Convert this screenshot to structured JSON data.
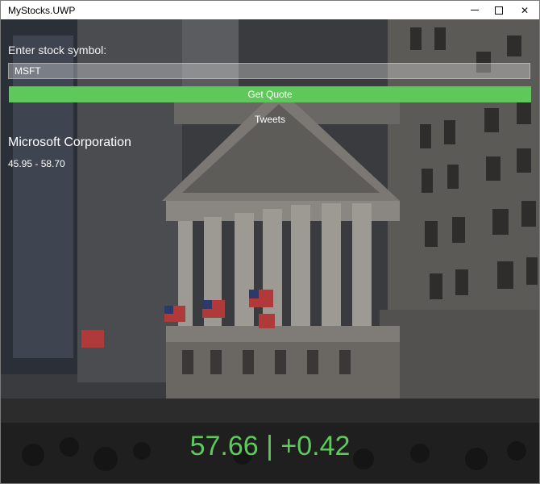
{
  "window": {
    "title": "MyStocks.UWP"
  },
  "form": {
    "prompt": "Enter stock symbol:",
    "symbol_value": "MSFT",
    "button_label": "Get Quote"
  },
  "links": {
    "tweets": "Tweets"
  },
  "quote": {
    "company": "Microsoft Corporation",
    "range": "45.95 - 58.70",
    "price_change": "57.66 | +0.42"
  },
  "colors": {
    "accent": "#5ec95a",
    "price_text": "#5fc95e"
  },
  "icons": [
    "minimize-icon",
    "maximize-icon",
    "close-icon"
  ]
}
